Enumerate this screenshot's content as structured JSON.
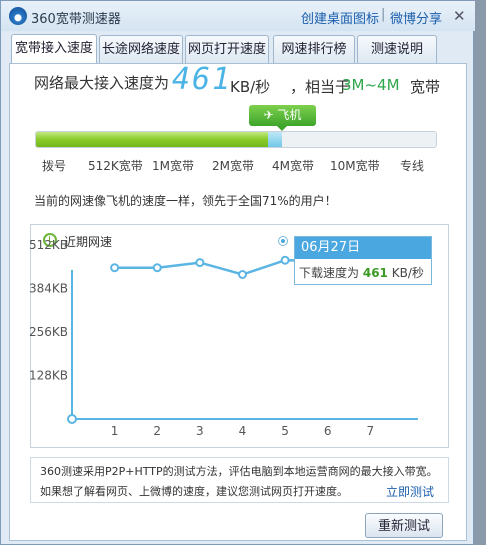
{
  "window": {
    "title": "360宽带测速器",
    "links": [
      "创建桌面图标",
      "微博分享"
    ],
    "close": "✕"
  },
  "tabs": [
    {
      "label": "宽带接入速度",
      "active": true
    },
    {
      "label": "长途网络速度",
      "active": false
    },
    {
      "label": "网页打开速度",
      "active": false
    },
    {
      "label": "网速排行榜",
      "active": false
    },
    {
      "label": "测速说明",
      "active": false
    }
  ],
  "result": {
    "headline_prefix": "网络最大接入速度为",
    "speed": "461",
    "unit": "KB/秒",
    "middle": "，相当于",
    "range": "3M~4M",
    "suffix": "宽带",
    "badge": "✈ 飞机",
    "progress_fraction": 0.61
  },
  "scale_labels": [
    "拨号",
    "512K宽带",
    "1M宽带",
    "2M宽带",
    "4M宽带",
    "10M宽带",
    "专线"
  ],
  "description": "当前的网速像飞机的速度一样，领先于全国71%的用户！",
  "chart": {
    "legend": "近期网速",
    "tooltip_date": "06月27日",
    "tooltip_text": "下载速度为",
    "tooltip_value": "461",
    "tooltip_unit": "KB/秒"
  },
  "chart_data": {
    "type": "line",
    "title": "近期网速",
    "x": [
      1,
      2,
      3,
      4,
      5,
      6,
      7
    ],
    "series": [
      {
        "values": [
          445,
          445,
          460,
          425,
          467,
          465,
          461
        ]
      }
    ],
    "ytick_labels": [
      "512KB",
      "384KB",
      "256KB",
      "128KB"
    ],
    "yticks": [
      512,
      384,
      256,
      128
    ],
    "ylim": [
      0,
      600
    ],
    "xlim": [
      0,
      8
    ],
    "grid": false,
    "color": "#5bb5e3"
  },
  "footer": {
    "line1": "360测速采用P2P+HTTP的测试方法，评估电脑到本地运营商网的最大接入带宽。",
    "line2": "如果想了解看网页、上微博的速度，建议您测试网页打开速度。",
    "link": "立即测试",
    "button": "重新测试"
  },
  "colors": {
    "accent_blue": "#4aa7df",
    "green": "#3ea52b",
    "link": "#1c5fad"
  }
}
